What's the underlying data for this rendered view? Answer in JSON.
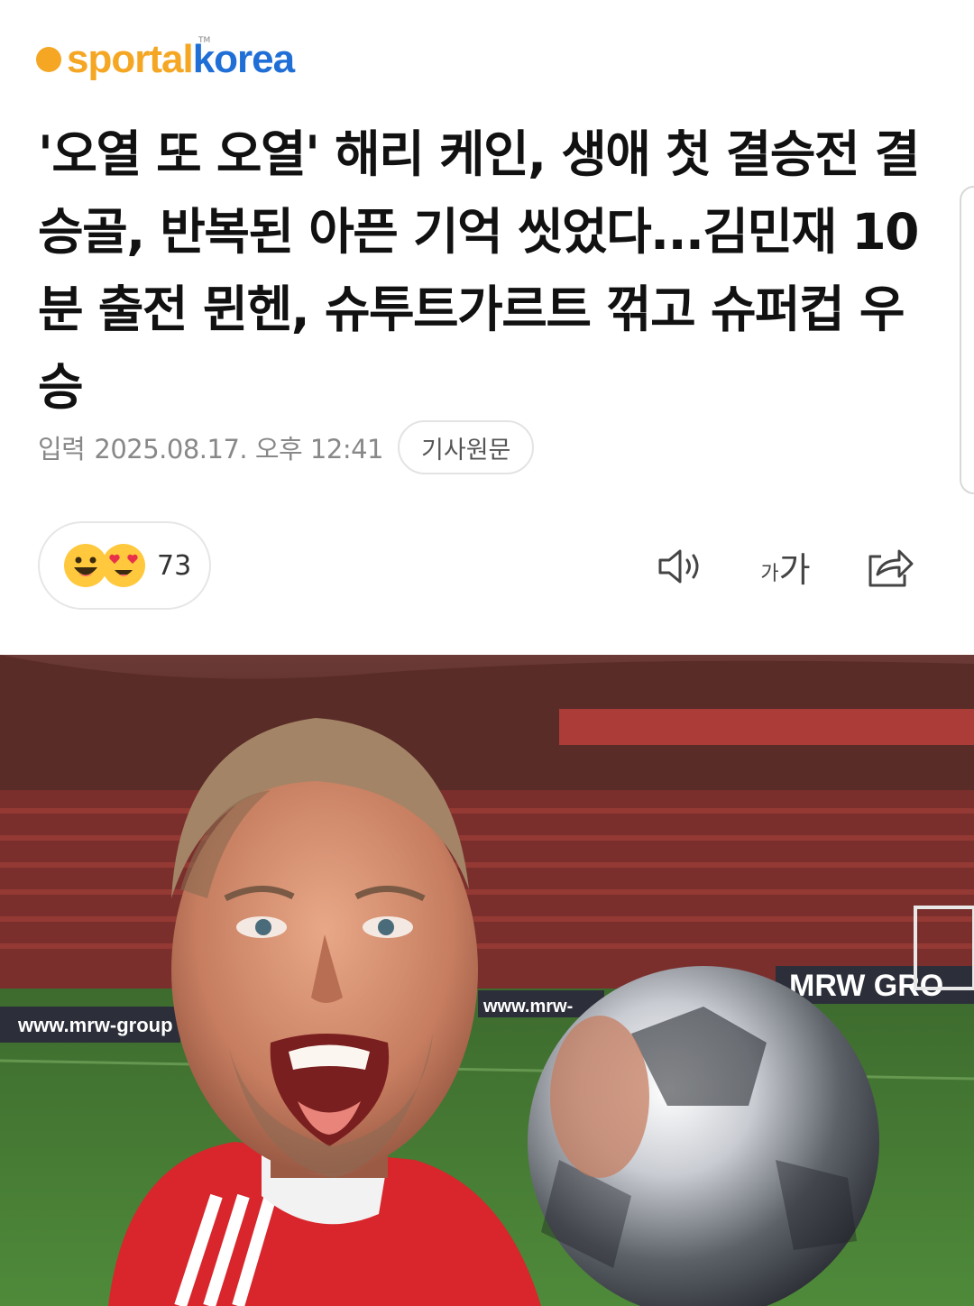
{
  "brand": {
    "logo_primary": "sportal",
    "logo_secondary": "korea",
    "logo_tm": "TM",
    "accent": "#f5a623",
    "secondary": "#1f6fd6"
  },
  "article": {
    "title": "'오열 또 오열' 해리 케인, 생애 첫 결승전 결승골, 반복된 아픈 기억 씻었다...김민재 10분 출전 뮌헨, 슈투트가르트 꺾고 슈퍼컵 우승",
    "meta_label": "입력",
    "meta_date": "2025.08.17. 오후 12:41",
    "original_button": "기사원문"
  },
  "reactions": {
    "count": "73",
    "emojis": [
      "grinning-face-icon",
      "heart-eyes-face-icon"
    ]
  },
  "toolbar": {
    "speaker_icon": "speaker-icon",
    "font_small": "가",
    "font_big": "가",
    "share_icon": "share-icon"
  },
  "photo": {
    "banner_left": "www.mrw-group",
    "banner_mid": "www.mrw-",
    "banner_right": "MRW GRO"
  }
}
